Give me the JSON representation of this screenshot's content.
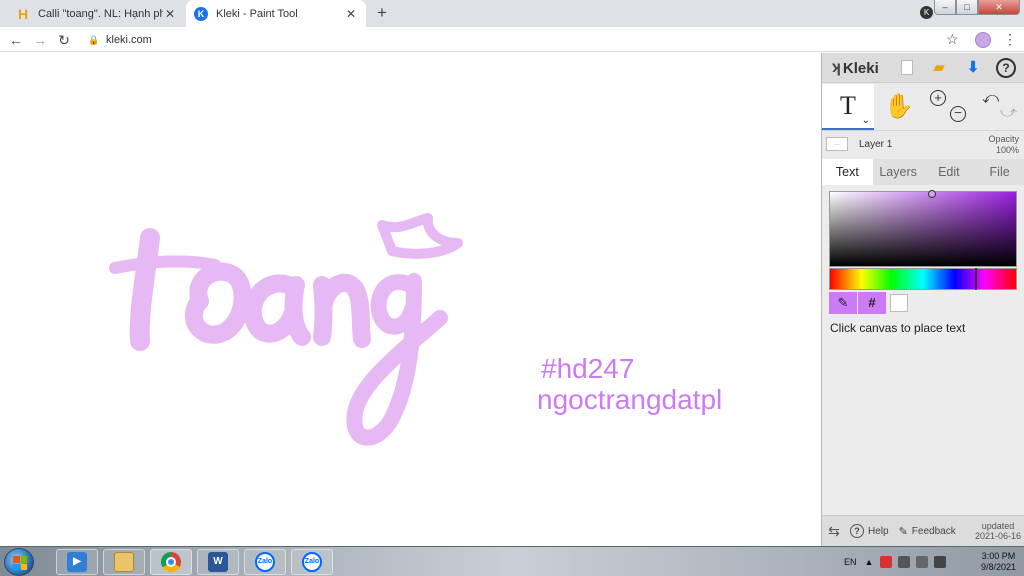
{
  "browser": {
    "tabs": [
      {
        "title": "Calli \"toang\". NL: Hạnh phúc nhấ",
        "favicon": "H",
        "active": false
      },
      {
        "title": "Kleki - Paint Tool",
        "favicon": "K",
        "active": true
      }
    ],
    "close_glyph": "✕",
    "newtab_glyph": "+",
    "url": "kleki.com",
    "back": "←",
    "forward": "→",
    "reload": "↻",
    "lock": "🔒",
    "star": "☆",
    "menu": "⋮",
    "window_min": "–",
    "window_max": "□",
    "window_close": "✕"
  },
  "canvas": {
    "lettering": "toang",
    "hashtag": "#hd247",
    "author": "ngoctrangdatpl",
    "ink_color": "#e6b9f5",
    "text_color": "#cc7af5"
  },
  "kleki": {
    "brand": "Kleki",
    "brand_mark": "ʞ",
    "help": "?",
    "tool_text": "T",
    "tool_text_caret": "⌄",
    "tool_hand": "✋",
    "zoom_in": "+",
    "zoom_out": "−",
    "undo": "⤺",
    "redo": "⤻",
    "layer": {
      "name": "Layer 1",
      "thumb": "..."
    },
    "opacity_label": "Opacity",
    "opacity_value": "100%",
    "tabs": [
      "Text",
      "Layers",
      "Edit",
      "File"
    ],
    "active_tab": "Text",
    "picker": {
      "pipette": "✎",
      "hex": "#",
      "primary_color": "#cc7af5"
    },
    "hint": "Click canvas to place text",
    "footer": {
      "swap": "⇆",
      "help": "Help",
      "help_glyph": "?",
      "feedback": "Feedback",
      "feedback_glyph": "✎",
      "updated_label": "updated",
      "updated_date": "2021-06-16"
    }
  },
  "taskbar": {
    "apps": [
      {
        "name": "media-player",
        "glyph": "▶"
      },
      {
        "name": "file-explorer",
        "glyph": ""
      },
      {
        "name": "chrome",
        "glyph": ""
      },
      {
        "name": "word",
        "glyph": "W"
      },
      {
        "name": "zalo",
        "glyph": "Zalo"
      },
      {
        "name": "zalo-2",
        "glyph": "Zalo"
      }
    ],
    "lang": "EN",
    "tray_arrow": "▲",
    "time": "3:00 PM",
    "date": "9/8/2021"
  }
}
